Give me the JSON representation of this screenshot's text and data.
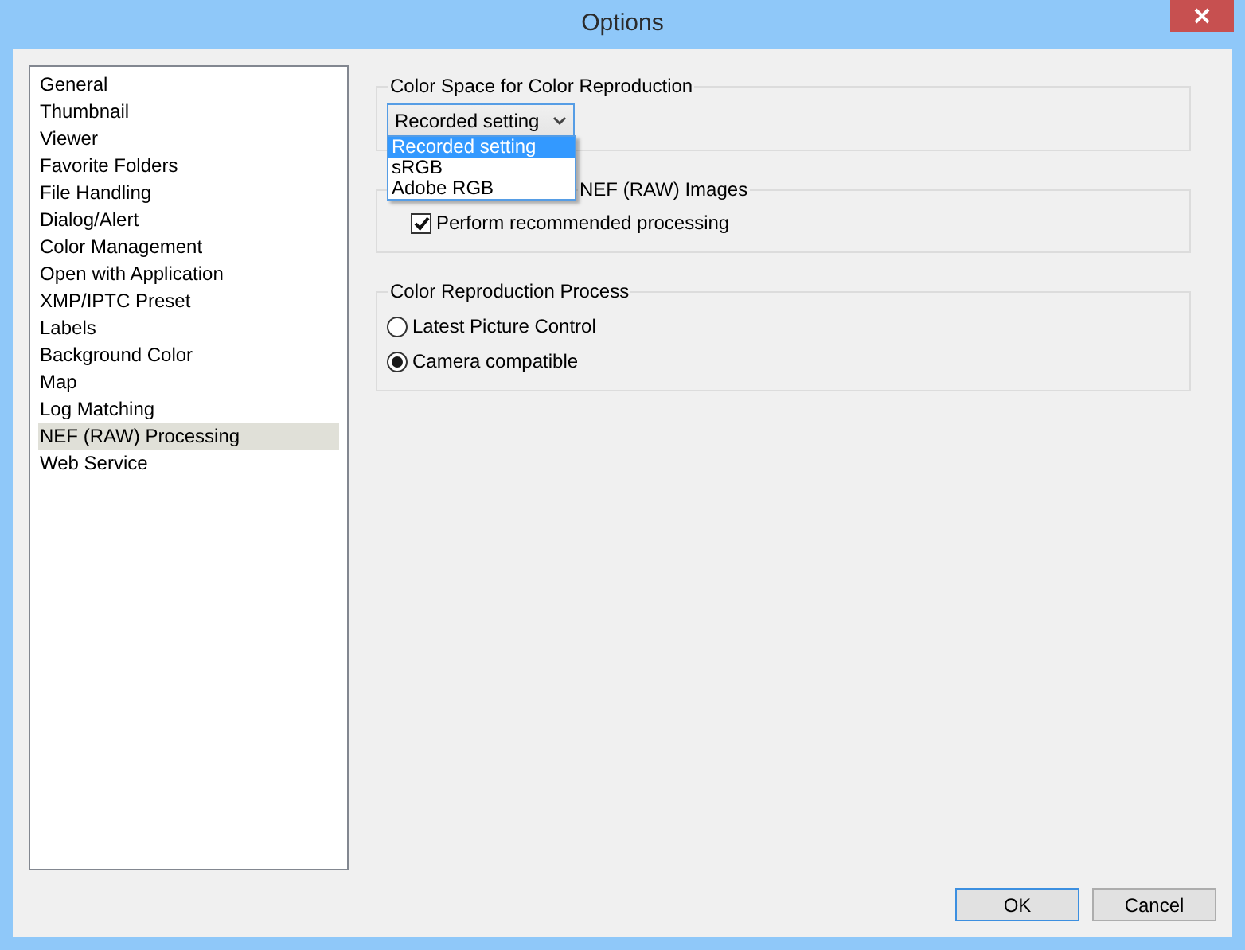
{
  "window": {
    "title": "Options"
  },
  "sidebar": {
    "items": [
      {
        "label": "General",
        "selected": false
      },
      {
        "label": "Thumbnail",
        "selected": false
      },
      {
        "label": "Viewer",
        "selected": false
      },
      {
        "label": "Favorite Folders",
        "selected": false
      },
      {
        "label": "File Handling",
        "selected": false
      },
      {
        "label": "Dialog/Alert",
        "selected": false
      },
      {
        "label": "Color Management",
        "selected": false
      },
      {
        "label": "Open with Application",
        "selected": false
      },
      {
        "label": "XMP/IPTC Preset",
        "selected": false
      },
      {
        "label": "Labels",
        "selected": false
      },
      {
        "label": "Background Color",
        "selected": false
      },
      {
        "label": "Map",
        "selected": false
      },
      {
        "label": "Log Matching",
        "selected": false
      },
      {
        "label": "NEF (RAW) Processing",
        "selected": true
      },
      {
        "label": "Web Service",
        "selected": false
      }
    ]
  },
  "color_space": {
    "title": "Color Space for Color Reproduction",
    "dropdown": {
      "value": "Recorded setting",
      "expanded": true,
      "options": [
        {
          "label": "Recorded setting",
          "selected": true
        },
        {
          "label": "sRGB",
          "selected": false
        },
        {
          "label": "Adobe RGB",
          "selected": false
        }
      ]
    }
  },
  "nef_images": {
    "title": "NEF (RAW) Images",
    "checkbox": {
      "label": "Perform recommended processing",
      "checked": true
    }
  },
  "process": {
    "title": "Color Reproduction Process",
    "radios": [
      {
        "label": "Latest Picture Control",
        "selected": false
      },
      {
        "label": "Camera compatible",
        "selected": true
      }
    ]
  },
  "buttons": [
    {
      "label": "OK",
      "default": true
    },
    {
      "label": "Cancel",
      "default": false
    }
  ]
}
